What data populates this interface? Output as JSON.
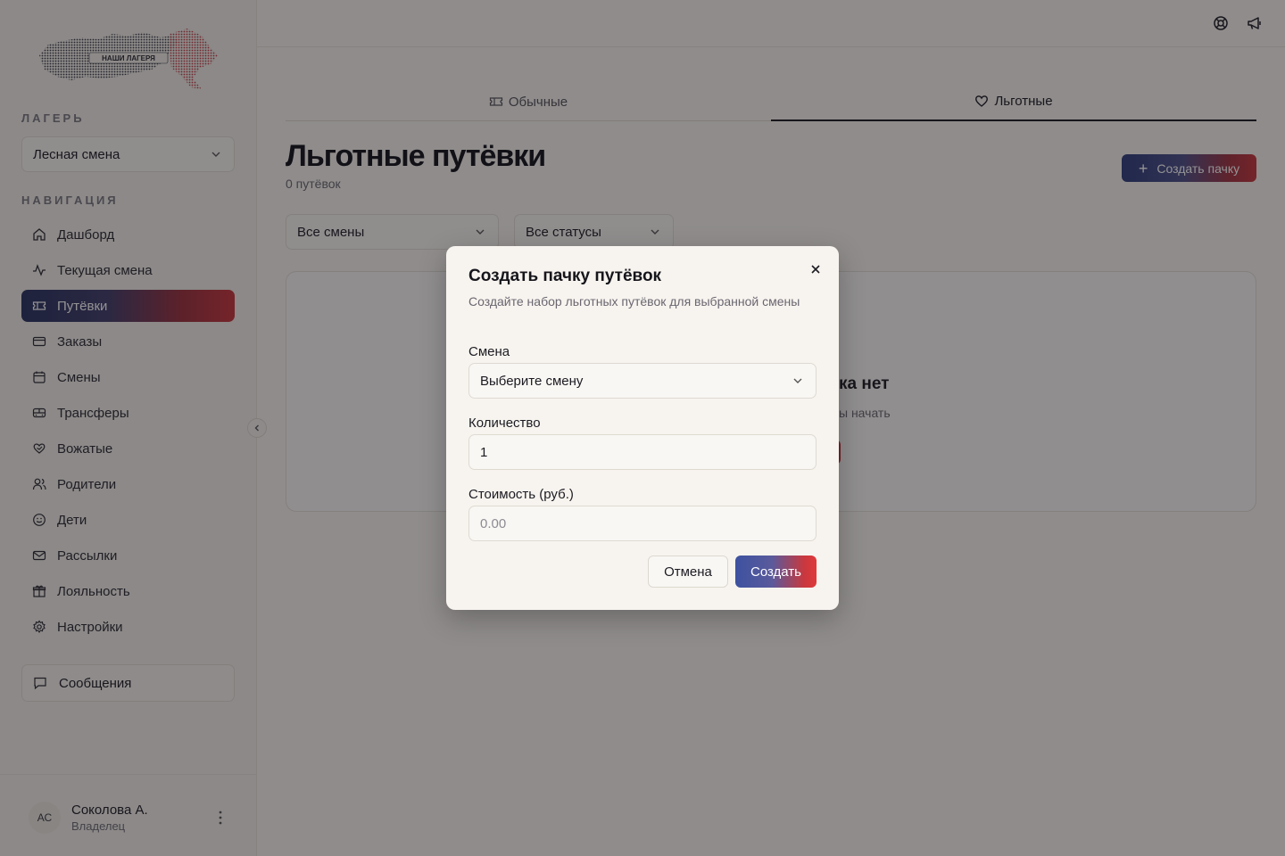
{
  "sidebar": {
    "logo_text": "НАШИ ЛАГЕРЯ",
    "camp_label": "ЛАГЕРЬ",
    "camp_select": "Лесная смена",
    "nav_label": "НАВИГАЦИЯ",
    "items": [
      {
        "label": "Дашборд",
        "icon": "home-icon"
      },
      {
        "label": "Текущая смена",
        "icon": "activity-icon"
      },
      {
        "label": "Путёвки",
        "icon": "ticket-icon"
      },
      {
        "label": "Заказы",
        "icon": "card-icon"
      },
      {
        "label": "Смены",
        "icon": "calendar-icon"
      },
      {
        "label": "Трансферы",
        "icon": "bus-icon"
      },
      {
        "label": "Вожатые",
        "icon": "heart-hand-icon"
      },
      {
        "label": "Родители",
        "icon": "users-icon"
      },
      {
        "label": "Дети",
        "icon": "smile-icon"
      },
      {
        "label": "Рассылки",
        "icon": "mail-icon"
      },
      {
        "label": "Лояльность",
        "icon": "gift-icon"
      },
      {
        "label": "Настройки",
        "icon": "gear-icon"
      }
    ],
    "active_index": 2,
    "messages_label": "Сообщения",
    "user": {
      "initials": "АС",
      "name": "Соколова А.",
      "role": "Владелец"
    }
  },
  "main": {
    "tabs": [
      {
        "label": "Обычные",
        "icon": "ticket-icon"
      },
      {
        "label": "Льготные",
        "icon": "heart-icon"
      }
    ],
    "active_tab": 1,
    "title": "Льготные путёвки",
    "subtitle": "0 путёвок",
    "create_batch_label": "Создать пачку",
    "filters": {
      "shifts": "Все смены",
      "statuses": "Все статусы"
    },
    "empty": {
      "title_fragment": "ка нет",
      "hint_fragment": "ы начать"
    }
  },
  "modal": {
    "title": "Создать пачку путёвок",
    "description": "Создайте набор льготных путёвок для выбранной смены",
    "shift_label": "Смена",
    "shift_placeholder": "Выберите смену",
    "quantity_label": "Количество",
    "quantity_value": "1",
    "price_label": "Стоимость (руб.)",
    "price_placeholder": "0.00",
    "cancel_label": "Отмена",
    "create_label": "Создать"
  },
  "colors": {
    "accent_blue": "#2d3c7a",
    "accent_red": "#c8343a",
    "background": "#f7f4ef"
  }
}
